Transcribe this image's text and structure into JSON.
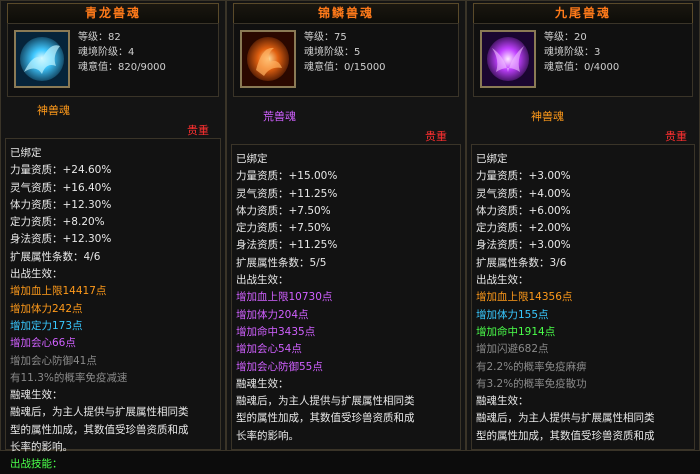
{
  "cards": [
    {
      "title": "青龙兽魂",
      "level_label": "等级：",
      "level": "82",
      "tier_label": "魂境阶级：",
      "tier": "4",
      "soul_label": "魂意值：",
      "soul": "820/9000",
      "type": "神兽魂",
      "quality": "贵重",
      "lines": [
        {
          "text": "已绑定",
          "color": "w"
        },
        {
          "text": "力量资质：+24.60%",
          "color": "w"
        },
        {
          "text": "灵气资质：+16.40%",
          "color": "w"
        },
        {
          "text": "体力资质：+12.30%",
          "color": "w"
        },
        {
          "text": "定力资质：+8.20%",
          "color": "w"
        },
        {
          "text": "身法资质：+12.30%",
          "color": "w"
        },
        {
          "text": "扩展属性条数：4/6",
          "color": "w"
        },
        {
          "text": "出战生效：",
          "color": "w"
        },
        {
          "text": "增加血上限14417点",
          "color": "o"
        },
        {
          "text": "增加体力242点",
          "color": "o"
        },
        {
          "text": "增加定力173点",
          "color": "c"
        },
        {
          "text": "增加会心66点",
          "color": "p"
        },
        {
          "text": "增加会心防御41点",
          "color": "g"
        },
        {
          "text": "有11.3%的概率免疫减速",
          "color": "g"
        },
        {
          "text": "融魂生效：",
          "color": "w"
        },
        {
          "text": "融魂后，为主人提供与扩展属性相同类",
          "color": "w"
        },
        {
          "text": "型的属性加成，其数值受珍兽资质和成",
          "color": "w"
        },
        {
          "text": "长率的影响。",
          "color": "w"
        },
        {
          "text": "出战技能：",
          "color": "gr"
        }
      ]
    },
    {
      "title": "锦鳞兽魂",
      "level_label": "等级：",
      "level": "75",
      "tier_label": "魂境阶级：",
      "tier": "5",
      "soul_label": "魂意值：",
      "soul": "0/15000",
      "type": "荒兽魂",
      "quality": "贵重",
      "lines": [
        {
          "text": "已绑定",
          "color": "w"
        },
        {
          "text": "力量资质：+15.00%",
          "color": "w"
        },
        {
          "text": "灵气资质：+11.25%",
          "color": "w"
        },
        {
          "text": "体力资质：+7.50%",
          "color": "w"
        },
        {
          "text": "定力资质：+7.50%",
          "color": "w"
        },
        {
          "text": "身法资质：+11.25%",
          "color": "w"
        },
        {
          "text": "扩展属性条数：5/5",
          "color": "w"
        },
        {
          "text": "出战生效：",
          "color": "w"
        },
        {
          "text": "增加血上限10730点",
          "color": "p"
        },
        {
          "text": "增加体力204点",
          "color": "p"
        },
        {
          "text": "增加命中3435点",
          "color": "p"
        },
        {
          "text": "增加会心54点",
          "color": "p"
        },
        {
          "text": "增加会心防御55点",
          "color": "p"
        },
        {
          "text": "融魂生效：",
          "color": "w"
        },
        {
          "text": "融魂后，为主人提供与扩展属性相同类",
          "color": "w"
        },
        {
          "text": "型的属性加成，其数值受珍兽资质和成",
          "color": "w"
        },
        {
          "text": "长率的影响。",
          "color": "w"
        }
      ]
    },
    {
      "title": "九尾兽魂",
      "level_label": "等级：",
      "level": "20",
      "tier_label": "魂境阶级：",
      "tier": "3",
      "soul_label": "魂意值：",
      "soul": "0/4000",
      "type": "神兽魂",
      "quality": "贵重",
      "lines": [
        {
          "text": "已绑定",
          "color": "w"
        },
        {
          "text": "力量资质：+3.00%",
          "color": "w"
        },
        {
          "text": "灵气资质：+4.00%",
          "color": "w"
        },
        {
          "text": "体力资质：+6.00%",
          "color": "w"
        },
        {
          "text": "定力资质：+2.00%",
          "color": "w"
        },
        {
          "text": "身法资质：+3.00%",
          "color": "w"
        },
        {
          "text": "扩展属性条数：3/6",
          "color": "w"
        },
        {
          "text": "出战生效：",
          "color": "w"
        },
        {
          "text": "增加血上限14356点",
          "color": "o"
        },
        {
          "text": "增加体力155点",
          "color": "c"
        },
        {
          "text": "增加命中1914点",
          "color": "gr"
        },
        {
          "text": "增加闪避682点",
          "color": "g"
        },
        {
          "text": "有2.2%的概率免疫麻痹",
          "color": "g"
        },
        {
          "text": "有3.2%的概率免疫散功",
          "color": "g"
        },
        {
          "text": "融魂生效：",
          "color": "w"
        },
        {
          "text": "融魂后，为主人提供与扩展属性相同类",
          "color": "w"
        },
        {
          "text": "型的属性加成，其数值受珍兽资质和成",
          "color": "w"
        }
      ]
    }
  ]
}
